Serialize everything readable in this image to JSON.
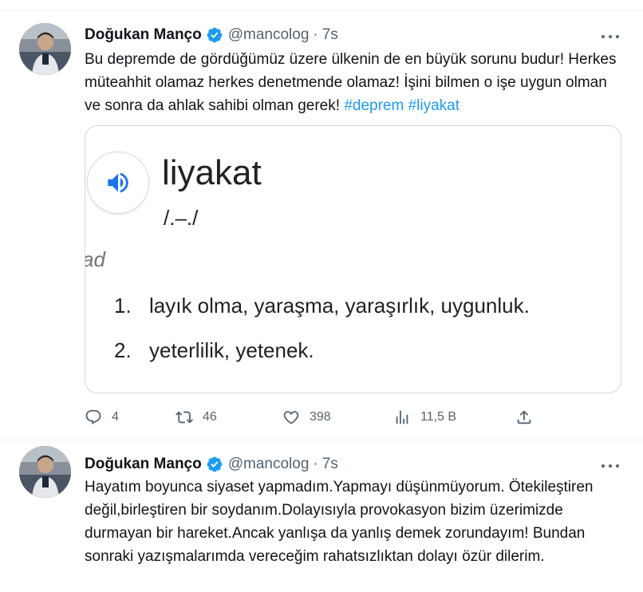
{
  "tweets": [
    {
      "author": {
        "name": "Doğukan Manço",
        "handle": "@mancolog",
        "separator": "·",
        "time": "7s",
        "verified": true
      },
      "text": "Bu depremde de gördüğümüz üzere ülkenin de en büyük sorunu budur! Herkes müteahhit olamaz herkes denetmende olamaz! İşini bilmen o işe uygun olman ve sonra da ahlak sahibi olman gerek! ",
      "hashtags": [
        "#deprem",
        "#liyakat"
      ],
      "card": {
        "word": "liyakat",
        "phonetic": "/.–./",
        "part_of_speech": "ad",
        "definitions": [
          {
            "num": "1.",
            "text": "layık olma, yaraşma, yaraşırlık, uygunluk."
          },
          {
            "num": "2.",
            "text": "yeterlilik, yetenek."
          }
        ]
      },
      "actions": {
        "replies": "4",
        "retweets": "46",
        "likes": "398",
        "views": "11,5 B"
      }
    },
    {
      "author": {
        "name": "Doğukan Manço",
        "handle": "@mancolog",
        "separator": "·",
        "time": "7s",
        "verified": true
      },
      "text": "Hayatım boyunca siyaset yapmadım.Yapmayı düşünmüyorum. Ötekileştiren değil,birleştiren bir soydanım.Dolayısıyla provokasyon bizim üzerimizde durmayan bir hareket.Ancak yanlışa da yanlış demek zorundayım! Bundan sonraki yazışmalarımda vereceğim rahatsızlıktan dolayı özür dilerim."
    }
  ],
  "colors": {
    "accent": "#1d9bf0",
    "secondary_text": "#536471",
    "border": "#cfd9de"
  },
  "icons": [
    "verified-badge-icon",
    "more-icon",
    "speaker-icon",
    "reply-icon",
    "retweet-icon",
    "like-icon",
    "views-icon",
    "share-icon"
  ]
}
